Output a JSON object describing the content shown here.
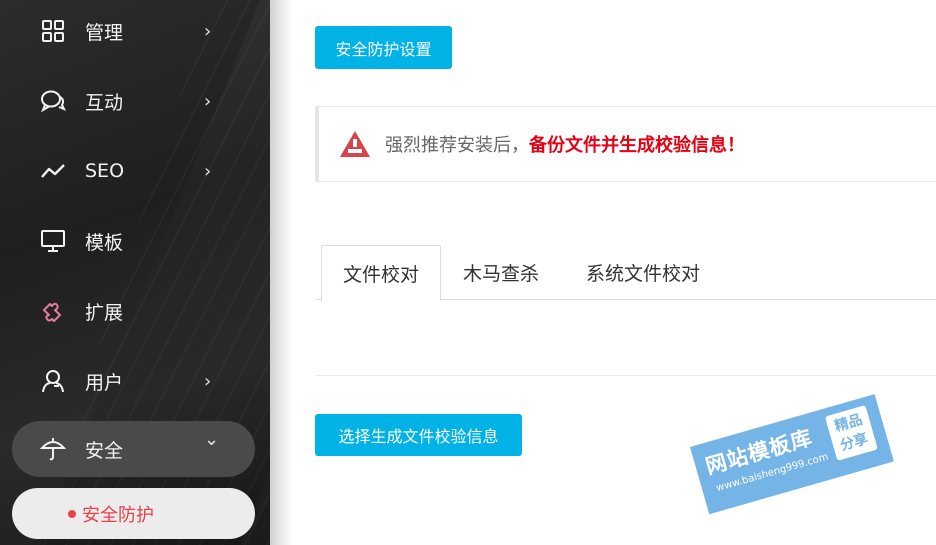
{
  "sidebar": {
    "items": [
      {
        "label": "管理",
        "icon": "grid-icon",
        "chevron": "›"
      },
      {
        "label": "互动",
        "icon": "chat-icon",
        "chevron": "›"
      },
      {
        "label": "SEO",
        "icon": "trend-icon",
        "chevron": "›"
      },
      {
        "label": "模板",
        "icon": "monitor-icon",
        "chevron": ""
      },
      {
        "label": "扩展",
        "icon": "puzzle-icon",
        "chevron": ""
      },
      {
        "label": "用户",
        "icon": "user-icon",
        "chevron": "›"
      },
      {
        "label": "安全",
        "icon": "umbrella-icon",
        "chevron": "⌄"
      }
    ],
    "sub_item": {
      "label": "安全防护"
    },
    "colors": {
      "active_text": "#e8414a",
      "bg": "#2a2a2a"
    }
  },
  "main": {
    "top_button": "安全防护设置",
    "alert": {
      "text": "强烈推荐安装后，",
      "highlight": "备份文件并生成校验信息！"
    },
    "tabs": [
      "文件校对",
      "木马查杀",
      "系统文件校对"
    ],
    "action_button": "选择生成文件校验信息",
    "accent": "#00b2e6"
  },
  "watermark": {
    "title": "网站模板库",
    "url": "www.baisheng999.com",
    "badge_line1": "精品",
    "badge_line2": "分享"
  }
}
